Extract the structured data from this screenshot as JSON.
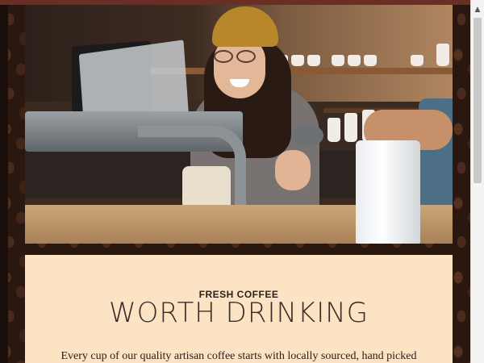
{
  "hero": {
    "image_alt": "Barista smiling while making coffee"
  },
  "about": {
    "subtitle": "FRESH COFFEE",
    "title": "WORTH DRINKING",
    "body": "Every cup of our quality artisan coffee starts with locally sourced, hand picked"
  },
  "scrollbar": {
    "up_icon": "triangle-up-icon"
  },
  "colors": {
    "card_background": "#fbe3c4",
    "frame_top": "#6b2e24",
    "page_background": "#2a1710"
  }
}
